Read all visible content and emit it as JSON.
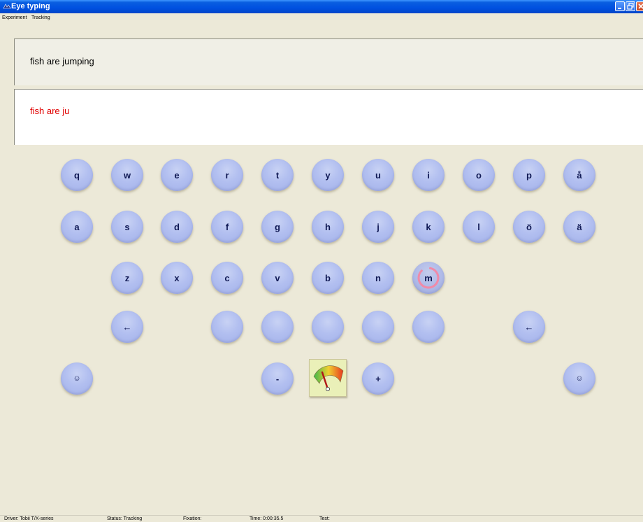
{
  "window": {
    "title": "Eye typing",
    "minimize_icon": "minimize-icon",
    "maximize_icon": "maximize-icon",
    "close_icon": "close-icon"
  },
  "menu": {
    "items": [
      "Experiment",
      "Tracking"
    ]
  },
  "target_phrase": "fish are jumping",
  "typed_text": "fish are ju",
  "typed_text_color": "#e00000",
  "keyboard": {
    "row1": [
      "q",
      "w",
      "e",
      "r",
      "t",
      "y",
      "u",
      "i",
      "o",
      "p",
      "å"
    ],
    "row2": [
      "a",
      "s",
      "d",
      "f",
      "g",
      "h",
      "j",
      "k",
      "l",
      "ö",
      "ä"
    ],
    "row3": [
      "z",
      "x",
      "c",
      "v",
      "b",
      "n",
      "m"
    ],
    "backspace_left": "←",
    "backspace_right": "←",
    "smiley_left": "☺",
    "smiley_right": "☺",
    "minus": "-",
    "plus": "+",
    "dwell_key": "m",
    "dwell_progress": 0.85,
    "gauge_icon": "dwell-time-gauge-icon"
  },
  "colors": {
    "key_fill": "#b2bff0",
    "key_text": "#111a55",
    "dwell_ring": "#f08aa8",
    "title_bar": "#0050e0"
  },
  "status": {
    "driver": "Driver: Tobii T/X-series",
    "status": "Status: Tracking",
    "fixation": "Fixation:",
    "time": "Time: 0:00:35.5",
    "test": "Test:"
  }
}
